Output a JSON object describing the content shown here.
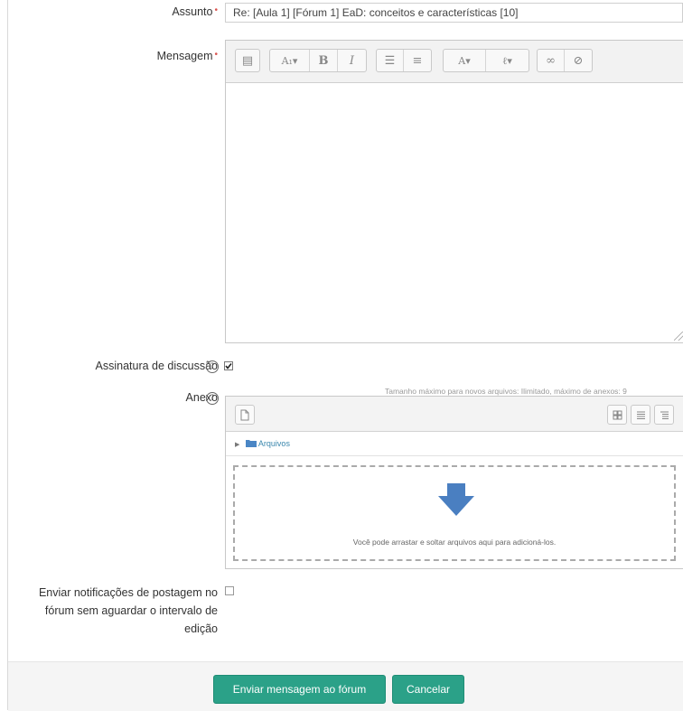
{
  "form": {
    "subject_label": "Assunto",
    "subject_value": "Re: [Aula 1] [Fórum 1] EaD: conceitos e características [10]",
    "message_label": "Mensagem",
    "required_mark": "•",
    "signature_label": "Assinatura de discussão",
    "signature_checked": true,
    "attachment_label": "Anexo",
    "notify_label_line1": "Enviar notificações de postagem no",
    "notify_label_line2": "fórum sem aguardar o intervalo de",
    "notify_label_line3": "edição",
    "notify_checked": false,
    "help_glyph": "?"
  },
  "editor": {
    "toolbar": [
      {
        "name": "show-more-icon",
        "glyph": "▤"
      },
      {
        "name": "paragraph-style-icon",
        "glyph": "A₁▾"
      },
      {
        "name": "bold-icon",
        "glyph": "B"
      },
      {
        "name": "italic-icon",
        "glyph": "I"
      },
      {
        "name": "unordered-list-icon",
        "glyph": "☰"
      },
      {
        "name": "ordered-list-icon",
        "glyph": "≡"
      },
      {
        "name": "insert-image-icon",
        "glyph": "A▾"
      },
      {
        "name": "media-icon",
        "glyph": "ℓ▾"
      },
      {
        "name": "link-icon",
        "glyph": "∞"
      },
      {
        "name": "unlink-icon",
        "glyph": "⊘"
      }
    ]
  },
  "filemanager": {
    "info": "Tamanho máximo para novos arquivos: Ilimitado, máximo de anexos: 9",
    "folder_label": "Arquivos",
    "drop_text": "Você pode arrastar e soltar arquivos aqui para adicioná-los."
  },
  "footer": {
    "submit_label": "Enviar mensagem ao fórum",
    "cancel_label": "Cancelar"
  },
  "colors": {
    "accent": "#2ba188",
    "required": "#d9534f",
    "link": "#3a87ad",
    "drop_arrow": "#4a7fc1"
  }
}
